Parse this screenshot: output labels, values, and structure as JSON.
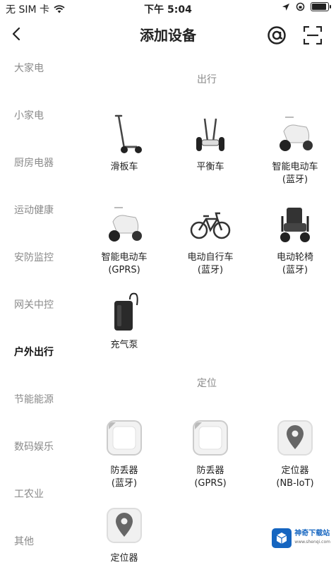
{
  "status_bar": {
    "carrier": "无 SIM 卡",
    "time": "下午 5:04",
    "battery_level": 0.85
  },
  "nav": {
    "title": "添加设备"
  },
  "sidebar": {
    "items": [
      {
        "label": "大家电",
        "active": false
      },
      {
        "label": "小家电",
        "active": false
      },
      {
        "label": "厨房电器",
        "active": false
      },
      {
        "label": "运动健康",
        "active": false
      },
      {
        "label": "安防监控",
        "active": false
      },
      {
        "label": "网关中控",
        "active": false
      },
      {
        "label": "户外出行",
        "active": true
      },
      {
        "label": "节能能源",
        "active": false
      },
      {
        "label": "数码娱乐",
        "active": false
      },
      {
        "label": "工农业",
        "active": false
      },
      {
        "label": "其他",
        "active": false
      }
    ]
  },
  "sections": [
    {
      "title": "出行",
      "devices": [
        {
          "line1": "滑板车",
          "line2": "",
          "icon": "scooter-icon"
        },
        {
          "line1": "平衡车",
          "line2": "",
          "icon": "balance-car-icon"
        },
        {
          "line1": "智能电动车",
          "line2": "(蓝牙)",
          "icon": "e-bike-icon"
        },
        {
          "line1": "智能电动车",
          "line2": "(GPRS)",
          "icon": "e-bike-icon"
        },
        {
          "line1": "电动自行车",
          "line2": "(蓝牙)",
          "icon": "bicycle-icon"
        },
        {
          "line1": "电动轮椅",
          "line2": "(蓝牙)",
          "icon": "wheelchair-icon"
        },
        {
          "line1": "充气泵",
          "line2": "",
          "icon": "air-pump-icon"
        }
      ]
    },
    {
      "title": "定位",
      "devices": [
        {
          "line1": "防丢器",
          "line2": "(蓝牙)",
          "icon": "tracker-tag-icon"
        },
        {
          "line1": "防丢器",
          "line2": "(GPRS)",
          "icon": "tracker-tag-icon"
        },
        {
          "line1": "定位器",
          "line2": "(NB-IoT)",
          "icon": "locator-icon"
        },
        {
          "line1": "定位器",
          "line2": "",
          "icon": "locator-icon"
        }
      ]
    }
  ],
  "watermark": {
    "text": "神奇下载站",
    "subtext": "www.shenqi.com"
  }
}
